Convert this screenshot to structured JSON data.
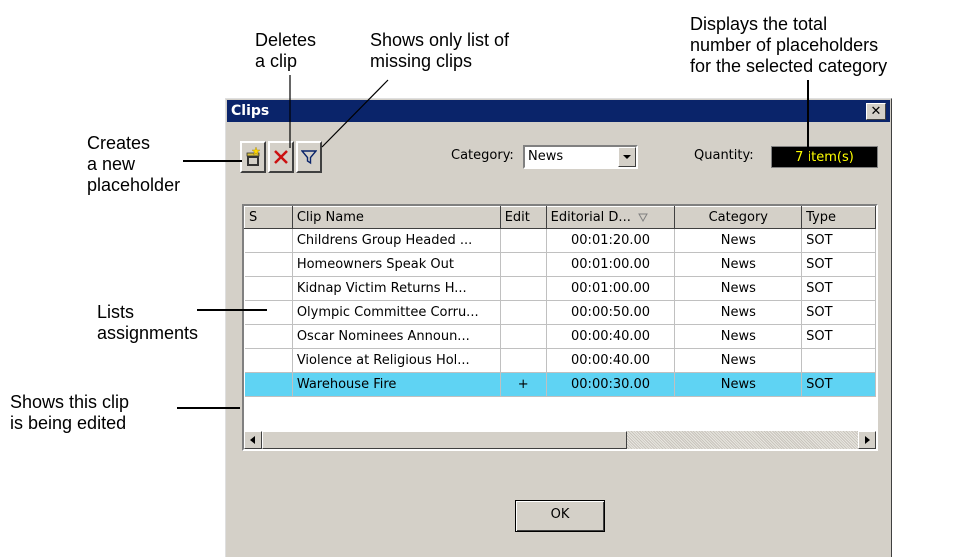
{
  "callouts": {
    "new_placeholder": "Creates\na new\nplaceholder",
    "delete_clip": "Deletes\na clip",
    "missing_clips": "Shows only list of\nmissing clips",
    "quantity_note": "Displays the total\nnumber of placeholders\nfor the selected category",
    "assignments": "Lists\nassignments",
    "being_edited": "Shows this clip\nis being edited"
  },
  "dialog": {
    "title": "Clips",
    "close_label": "✕",
    "category_label": "Category:",
    "category_value": "News",
    "quantity_label": "Quantity:",
    "quantity_value": "7 item(s)",
    "ok_label": "OK"
  },
  "table": {
    "columns": [
      "S",
      "Clip Name",
      "Edit",
      "Editorial D...",
      "Category",
      "Type"
    ],
    "rows": [
      {
        "s": "",
        "name": "Childrens Group Headed ...",
        "edit": "",
        "duration": "00:01:20.00",
        "category": "News",
        "type": "SOT"
      },
      {
        "s": "",
        "name": "Homeowners Speak Out",
        "edit": "",
        "duration": "00:01:00.00",
        "category": "News",
        "type": "SOT"
      },
      {
        "s": "",
        "name": "Kidnap Victim Returns H...",
        "edit": "",
        "duration": "00:01:00.00",
        "category": "News",
        "type": "SOT"
      },
      {
        "s": "",
        "name": "Olympic Committee Corru...",
        "edit": "",
        "duration": "00:00:50.00",
        "category": "News",
        "type": "SOT"
      },
      {
        "s": "",
        "name": "Oscar Nominees Announ...",
        "edit": "",
        "duration": "00:00:40.00",
        "category": "News",
        "type": "SOT"
      },
      {
        "s": "",
        "name": "Violence at Religious Hol...",
        "edit": "",
        "duration": "00:00:40.00",
        "category": "News",
        "type": ""
      },
      {
        "s": "",
        "name": "Warehouse Fire",
        "edit": "+",
        "duration": "00:00:30.00",
        "category": "News",
        "type": "SOT",
        "selected": true
      }
    ]
  },
  "colors": {
    "title_bar": "#0a246a",
    "selection": "#5fd3f3",
    "quantity_text": "#ffff00"
  },
  "icons": [
    "new-placeholder-icon",
    "delete-icon",
    "filter-icon",
    "dropdown-arrow-icon",
    "close-icon"
  ]
}
